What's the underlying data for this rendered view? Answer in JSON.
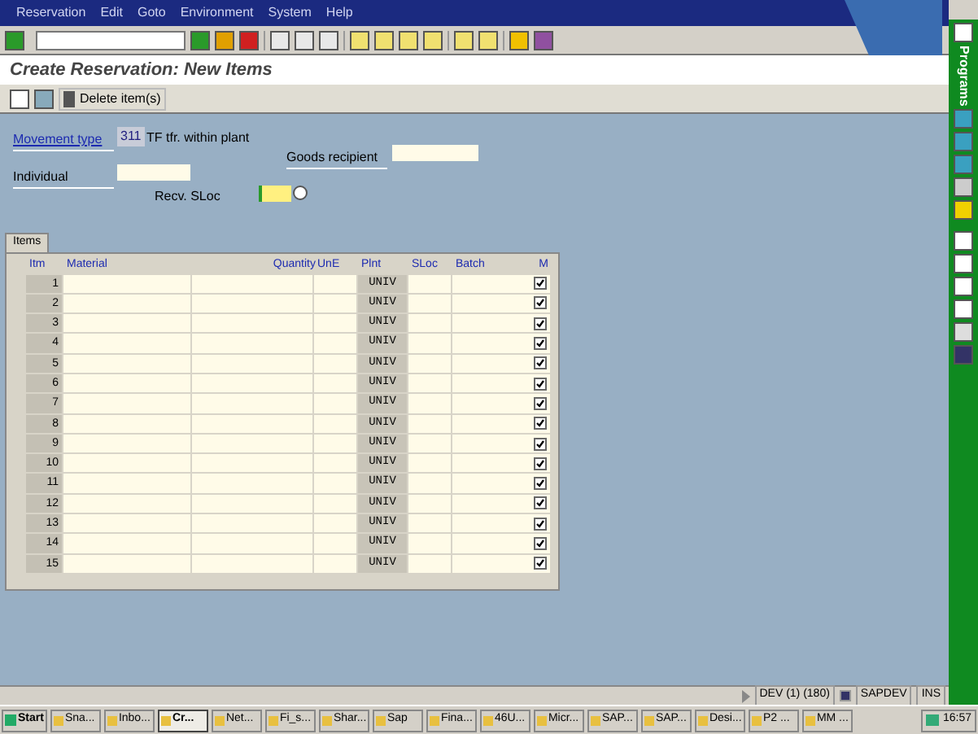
{
  "menu": [
    "Reservation",
    "Edit",
    "Goto",
    "Environment",
    "System",
    "Help"
  ],
  "title": "Create Reservation: New Items",
  "app_toolbar": {
    "delete_button": "Delete item(s)"
  },
  "header": {
    "movement_type_label": "Movement type",
    "movement_type": "311",
    "movement_type_text": "TF tfr. within plant",
    "goods_recipient_label": "Goods recipient",
    "individual_label": "Individual",
    "recv_sloc_label": "Recv. SLoc"
  },
  "items": {
    "tab": "Items",
    "columns": [
      "Itm",
      "Material",
      "Quantity",
      "UnE",
      "Plnt",
      "SLoc",
      "Batch",
      "M"
    ],
    "rows": [
      {
        "itm": "1",
        "plant": "UNIV",
        "m": true
      },
      {
        "itm": "2",
        "plant": "UNIV",
        "m": true
      },
      {
        "itm": "3",
        "plant": "UNIV",
        "m": true
      },
      {
        "itm": "4",
        "plant": "UNIV",
        "m": true
      },
      {
        "itm": "5",
        "plant": "UNIV",
        "m": true
      },
      {
        "itm": "6",
        "plant": "UNIV",
        "m": true
      },
      {
        "itm": "7",
        "plant": "UNIV",
        "m": true
      },
      {
        "itm": "8",
        "plant": "UNIV",
        "m": true
      },
      {
        "itm": "9",
        "plant": "UNIV",
        "m": true
      },
      {
        "itm": "10",
        "plant": "UNIV",
        "m": true
      },
      {
        "itm": "11",
        "plant": "UNIV",
        "m": true
      },
      {
        "itm": "12",
        "plant": "UNIV",
        "m": true
      },
      {
        "itm": "13",
        "plant": "UNIV",
        "m": true
      },
      {
        "itm": "14",
        "plant": "UNIV",
        "m": true
      },
      {
        "itm": "15",
        "plant": "UNIV",
        "m": true
      }
    ]
  },
  "side_bar": {
    "label": "Programs"
  },
  "status_bar": {
    "system": "DEV (1) (180)",
    "server": "SAPDEV",
    "mode": "INS"
  },
  "taskbar": {
    "start": "Start",
    "clock": "16:57",
    "tasks": [
      {
        "label": "Sna...",
        "selected": false
      },
      {
        "label": "Inbo...",
        "selected": false
      },
      {
        "label": "Cr...",
        "selected": true
      },
      {
        "label": "Net...",
        "selected": false
      },
      {
        "label": "Fi_s...",
        "selected": false
      },
      {
        "label": "Shar...",
        "selected": false
      },
      {
        "label": "Sap",
        "selected": false
      },
      {
        "label": "Fina...",
        "selected": false
      },
      {
        "label": "46U...",
        "selected": false
      },
      {
        "label": "Micr...",
        "selected": false
      },
      {
        "label": "SAP...",
        "selected": false
      },
      {
        "label": "SAP...",
        "selected": false
      },
      {
        "label": "Desi...",
        "selected": false
      },
      {
        "label": "P2 ...",
        "selected": false
      },
      {
        "label": "MM ...",
        "selected": false
      }
    ]
  }
}
